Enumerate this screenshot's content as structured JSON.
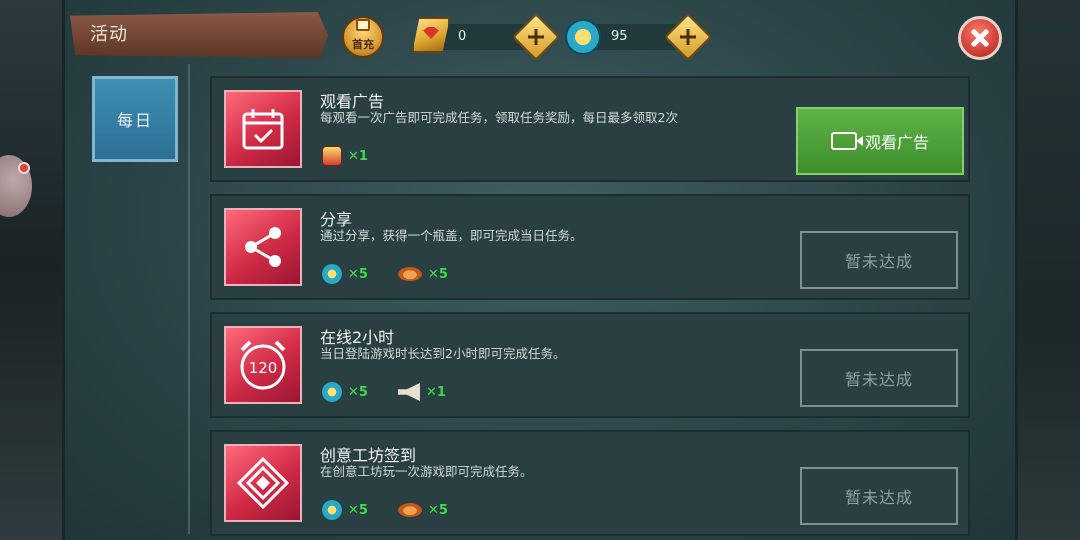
{
  "header": {
    "title": "活动",
    "topup_label": "首充",
    "gold": {
      "value": "0",
      "icon": "gold-ticket-icon"
    },
    "tokens": {
      "value": "95",
      "icon": "sun-token-icon"
    }
  },
  "nav": {
    "tabs": [
      {
        "label": "每日",
        "active": true
      }
    ]
  },
  "tasks": [
    {
      "title": "观看广告",
      "desc": "每观看一次广告即可完成任务，领取任务奖励，每日最多领取2次",
      "icon": "calendar-check-icon",
      "rewards": [
        {
          "icon": "gift-box-icon",
          "text": "✕1"
        }
      ],
      "button": {
        "label": "观看广告",
        "state": "active"
      }
    },
    {
      "title": "分享",
      "desc": "通过分享，获得一个瓶盖，即可完成当日任务。",
      "icon": "share-icon",
      "rewards": [
        {
          "icon": "token-icon",
          "text": "✕5"
        },
        {
          "icon": "bottle-cap-icon",
          "text": "✕5"
        }
      ],
      "button": {
        "label": "暂未达成",
        "state": "disabled"
      }
    },
    {
      "title": "在线2小时",
      "desc": "当日登陆游戏时长达到2小时即可完成任务。",
      "icon": "alarm-clock-icon",
      "icon_text": "120",
      "rewards": [
        {
          "icon": "token-icon",
          "text": "✕5"
        },
        {
          "icon": "horn-icon",
          "text": "✕1"
        }
      ],
      "button": {
        "label": "暂未达成",
        "state": "disabled"
      }
    },
    {
      "title": "创意工坊签到",
      "desc": "在创意工坊玩一次游戏即可完成任务。",
      "icon": "diamond-badge-icon",
      "rewards": [
        {
          "icon": "token-icon",
          "text": "✕5"
        },
        {
          "icon": "bottle-cap-icon",
          "text": "✕5"
        }
      ],
      "button": {
        "label": "暂未达成",
        "state": "disabled"
      }
    }
  ],
  "colors": {
    "accent_green": "#4a9f36",
    "reward_green": "#3fdc4a",
    "task_icon_red": "#d02a45"
  }
}
